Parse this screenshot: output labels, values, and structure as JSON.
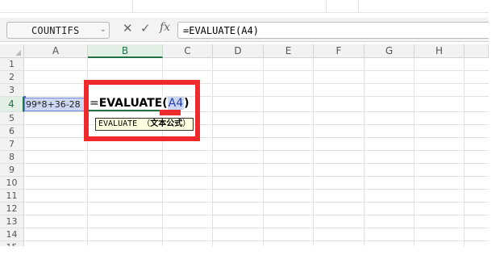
{
  "formula_bar": {
    "name_box": "COUNTIFS",
    "name_box_dropdown_icon": "chevron-down-icon",
    "cancel_icon": "close-icon",
    "confirm_icon": "check-icon",
    "fx_label": "fx",
    "formula_text": "=EVALUATE(A4)"
  },
  "columns": [
    "A",
    "B",
    "C",
    "D",
    "E",
    "F",
    "G",
    "H"
  ],
  "active_column": "B",
  "rows": [
    "1",
    "2",
    "3",
    "4",
    "5",
    "6",
    "7",
    "8",
    "9",
    "10",
    "11",
    "12",
    "13",
    "14",
    "15"
  ],
  "active_row": "4",
  "cells": {
    "A4": "99*8+36-28",
    "B4_editor": {
      "equals": "=",
      "function": "EVALUATE",
      "open_paren": "(",
      "reference": "A4",
      "close_paren": ")"
    }
  },
  "tooltip": {
    "function": "EVALUATE",
    "open": " （",
    "argument": "文本公式",
    "close": "）"
  },
  "colors": {
    "accent_green": "#217346",
    "highlight_red": "#ef2a2d",
    "reference_fill": "#cdd6f3"
  }
}
